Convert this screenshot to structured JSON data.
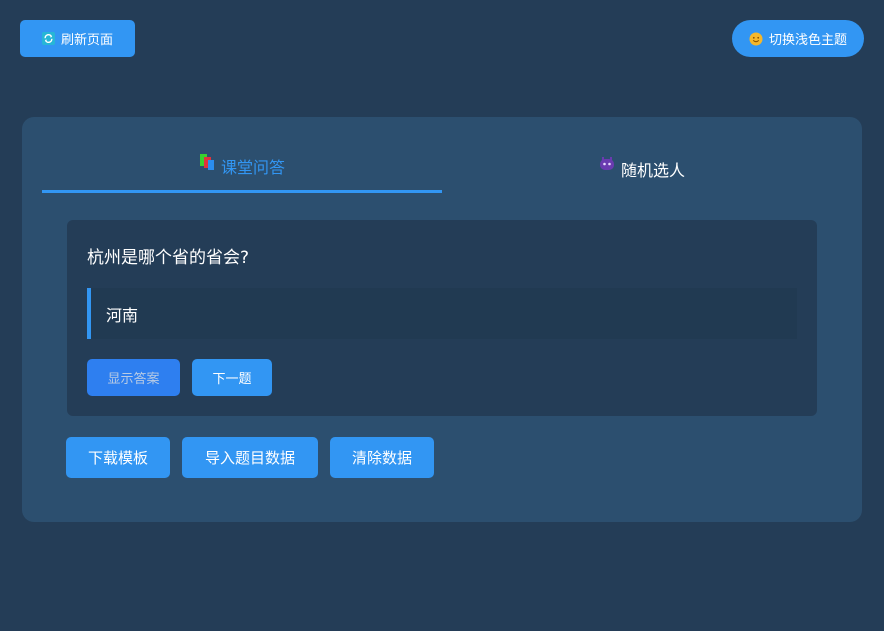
{
  "top": {
    "refresh_label": "刷新页面",
    "refresh_icon": "refresh-icon",
    "theme_label": "切换浅色主题",
    "theme_icon": "sun-face-icon"
  },
  "tabs": [
    {
      "label": "课堂问答",
      "icon": "books-icon",
      "active": true
    },
    {
      "label": "随机选人",
      "icon": "alien-monster-icon",
      "active": false
    }
  ],
  "quiz": {
    "question": "杭州是哪个省的省会?",
    "answer": "河南",
    "show_answer_label": "显示答案",
    "next_label": "下一题"
  },
  "actions": {
    "download_label": "下载模板",
    "import_label": "导入题目数据",
    "clear_label": "清除数据"
  },
  "colors": {
    "background": "#243d57",
    "card": "#2c4f6f",
    "accent": "#3296f3"
  }
}
